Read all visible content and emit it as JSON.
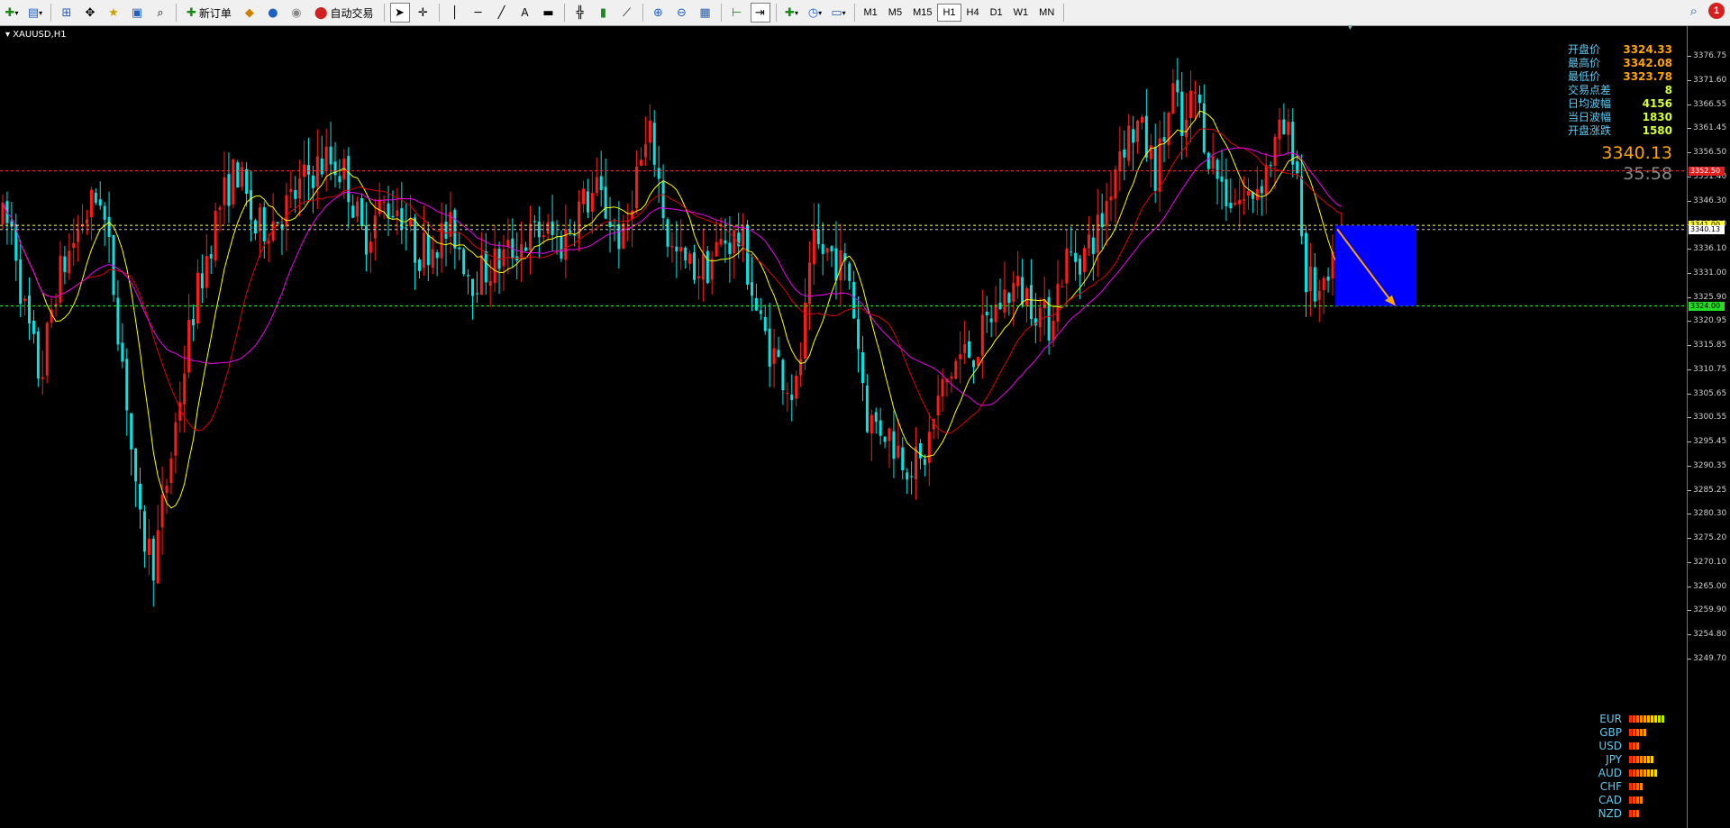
{
  "toolbar": {
    "new_order_label": "新订单",
    "auto_trading_label": "自动交易",
    "timeframes": [
      "M1",
      "M5",
      "M15",
      "H1",
      "H4",
      "D1",
      "W1",
      "MN"
    ],
    "active_timeframe": "H1",
    "notification_count": "1"
  },
  "chart": {
    "symbol_label": "XAUUSD,H1",
    "colors": {
      "bull_candle": "#ff1a1a",
      "bear_candle": "#00e5e5",
      "ma_fast": "#ffff00",
      "ma_mid": "#dd0000",
      "ma_slow": "#ee00ee",
      "resistance_line": "#ff3030",
      "ask_line": "#ffff66",
      "target_line": "#33ff33",
      "forecast_box": "#0000ff",
      "forecast_arrow": "#ffa500"
    },
    "price_axis": {
      "labels": [
        "3376.75",
        "3371.60",
        "3366.55",
        "3361.45",
        "3356.50",
        "3351.40",
        "3346.30",
        "3341.20",
        "3336.10",
        "3331.00",
        "3325.90",
        "3320.95",
        "3315.85",
        "3310.75",
        "3305.65",
        "3300.55",
        "3295.45",
        "3290.35",
        "3285.25",
        "3280.30",
        "3275.20",
        "3270.10",
        "3265.00",
        "3259.90",
        "3254.80",
        "3249.70"
      ],
      "resistance_tag": "3352.50",
      "ask_tag": "3341.00",
      "bid_tag": "3340.13",
      "target_tag": "3324.00"
    },
    "info_panel": [
      {
        "label": "开盘价",
        "value": "3324.33",
        "tone": "orange"
      },
      {
        "label": "最高价",
        "value": "3342.08",
        "tone": "orange"
      },
      {
        "label": "最低价",
        "value": "3323.78",
        "tone": "orange"
      },
      {
        "label": "交易点差",
        "value": "8",
        "tone": "green"
      },
      {
        "label": "日均波幅",
        "value": "4156",
        "tone": "green"
      },
      {
        "label": "当日波幅",
        "value": "1830",
        "tone": "green"
      },
      {
        "label": "开盘涨跌",
        "value": "1580",
        "tone": "green"
      }
    ],
    "current_price": "3340.13",
    "bar_timer": "35:58",
    "currency_strength": [
      {
        "name": "EUR",
        "level": 10
      },
      {
        "name": "GBP",
        "level": 5
      },
      {
        "name": "USD",
        "level": 3
      },
      {
        "name": "JPY",
        "level": 7
      },
      {
        "name": "AUD",
        "level": 8
      },
      {
        "name": "CHF",
        "level": 4
      },
      {
        "name": "CAD",
        "level": 4
      },
      {
        "name": "NZD",
        "level": 3
      }
    ]
  }
}
